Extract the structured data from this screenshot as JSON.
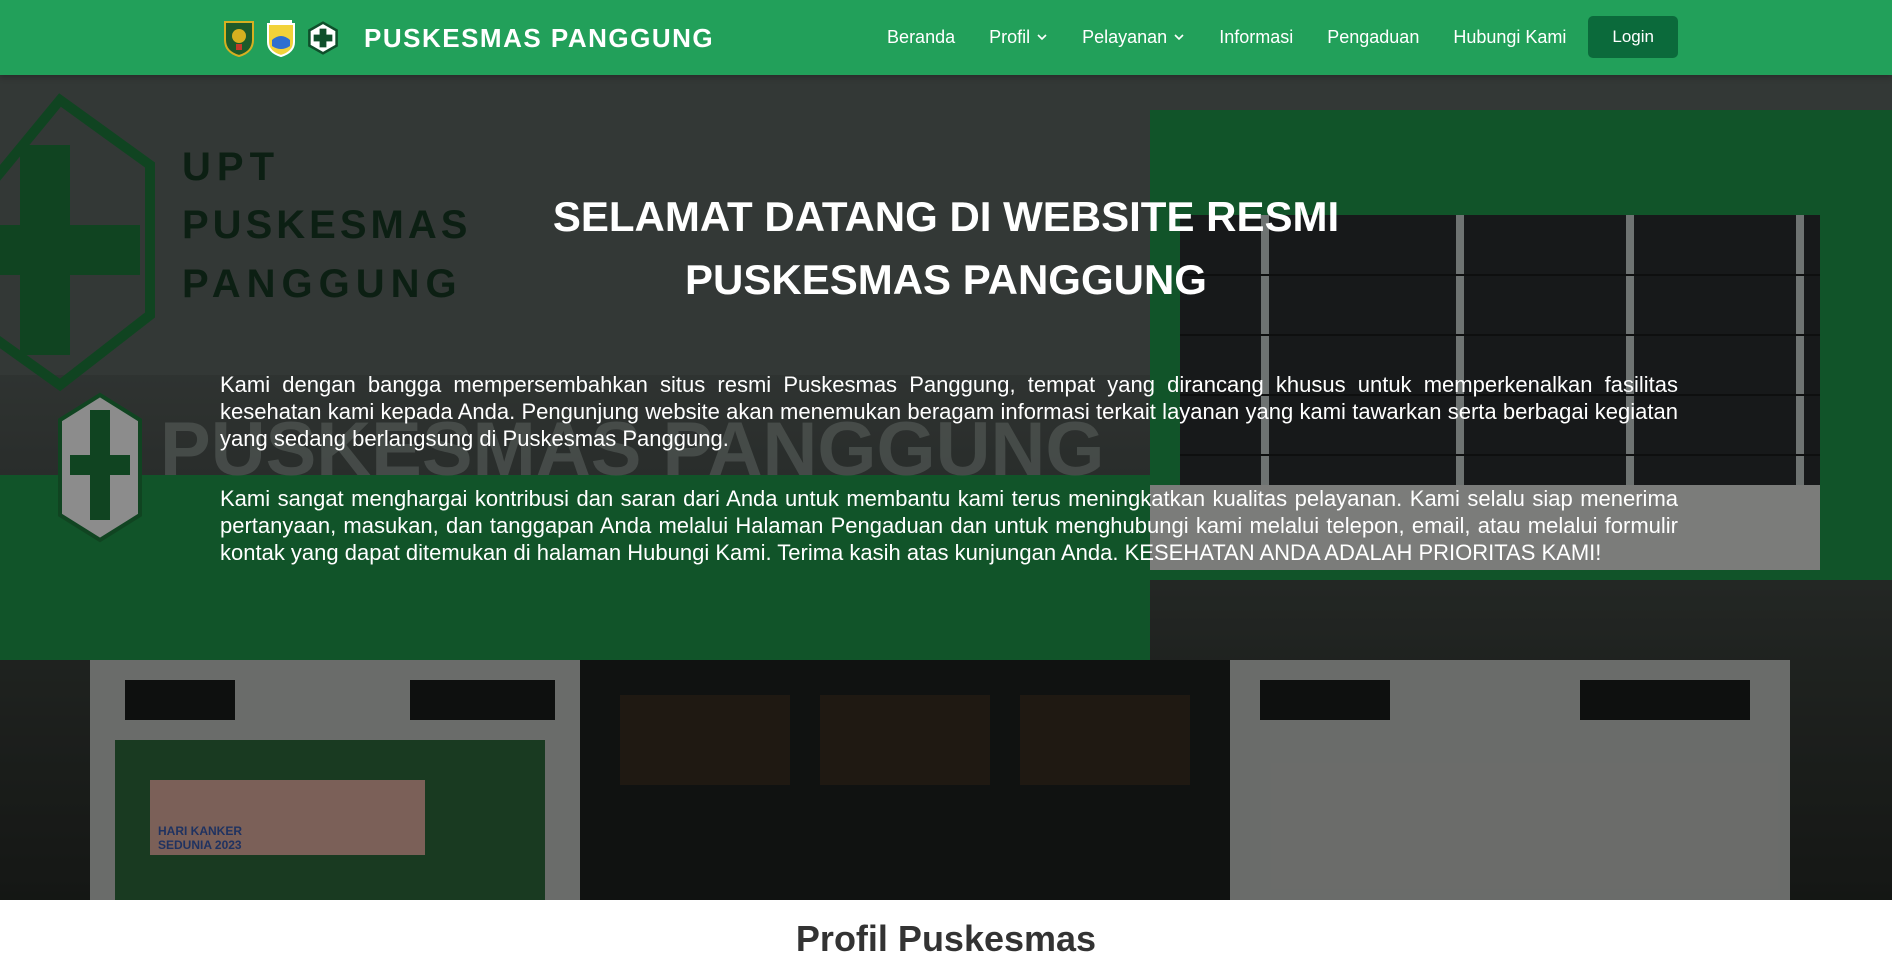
{
  "brand": {
    "name": "PUSKESMAS PANGGUNG",
    "logos": [
      "regional-emblem-icon",
      "district-emblem-icon",
      "puskesmas-cross-icon"
    ],
    "primary_color": "#22a05a",
    "button_color": "#0b6a3b"
  },
  "nav": {
    "items": [
      {
        "label": "Beranda",
        "dropdown": false
      },
      {
        "label": "Profil",
        "dropdown": true
      },
      {
        "label": "Pelayanan",
        "dropdown": true
      },
      {
        "label": "Informasi",
        "dropdown": false
      },
      {
        "label": "Pengaduan",
        "dropdown": false
      },
      {
        "label": "Hubungi Kami",
        "dropdown": false
      }
    ],
    "login_label": "Login"
  },
  "hero": {
    "title_line1": "SELAMAT DATANG DI WEBSITE RESMI",
    "title_line2": "PUSKESMAS PANGGUNG",
    "paragraph1": "Kami dengan bangga mempersembahkan situs resmi Puskesmas Panggung, tempat yang dirancang khusus untuk memperkenalkan fasilitas kesehatan kami kepada Anda. Pengunjung website akan menemukan beragam informasi terkait layanan yang kami tawarkan serta berbagai kegiatan yang sedang berlangsung di Puskesmas Panggung.",
    "paragraph2": "Kami sangat menghargai kontribusi dan saran dari Anda untuk membantu kami terus meningkatkan kualitas pelayanan. Kami selalu siap menerima pertanyaan, masukan, dan tanggapan Anda melalui Halaman Pengaduan dan untuk menghubungi kami melalui telepon, email, atau melalui formulir kontak yang dapat ditemukan di halaman Hubungi Kami. Terima kasih atas kunjungan Anda. KESEHATAN ANDA ADALAH PRIORITAS KAMI!",
    "background_sign_line1": "UPT",
    "background_sign_line2": "PUSKESMAS",
    "background_sign_line3": "PANGGUNG",
    "background_facade_text": "PUSKESMAS PANGGUNG",
    "banner_text1": "HARI KANKER",
    "banner_text2": "SEDUNIA 2023"
  },
  "section": {
    "title": "Profil Puskesmas"
  }
}
